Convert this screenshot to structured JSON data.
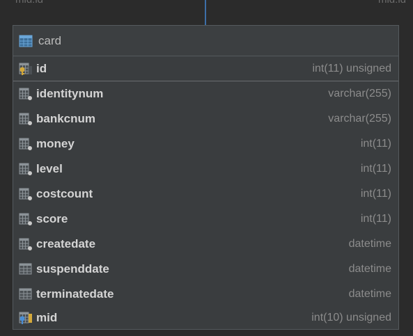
{
  "above": {
    "left_label": "mid:id",
    "right_label": "mid:id"
  },
  "table": {
    "name": "card",
    "columns": [
      {
        "name": "id",
        "type": "int(11) unsigned",
        "icon": "primary-key-column-icon"
      },
      {
        "name": "identitynum",
        "type": "varchar(255)",
        "icon": "column-icon"
      },
      {
        "name": "bankcnum",
        "type": "varchar(255)",
        "icon": "column-icon"
      },
      {
        "name": "money",
        "type": "int(11)",
        "icon": "column-icon"
      },
      {
        "name": "level",
        "type": "int(11)",
        "icon": "column-icon"
      },
      {
        "name": "costcount",
        "type": "int(11)",
        "icon": "column-icon"
      },
      {
        "name": "score",
        "type": "int(11)",
        "icon": "column-icon"
      },
      {
        "name": "createdate",
        "type": "datetime",
        "icon": "column-icon"
      },
      {
        "name": "suspenddate",
        "type": "datetime",
        "icon": "nullable-column-icon"
      },
      {
        "name": "terminatedate",
        "type": "datetime",
        "icon": "nullable-column-icon"
      },
      {
        "name": "mid",
        "type": "int(10) unsigned",
        "icon": "foreign-key-column-icon"
      }
    ]
  },
  "colors": {
    "background": "#2b2b2b",
    "table_bg": "#3a3d3f",
    "column_name": "#d4d4d4",
    "column_type": "#8c8c8c",
    "key_gold": "#d4a93a",
    "fk_blue": "#4a8fd6",
    "connector": "#3d6fa8"
  }
}
